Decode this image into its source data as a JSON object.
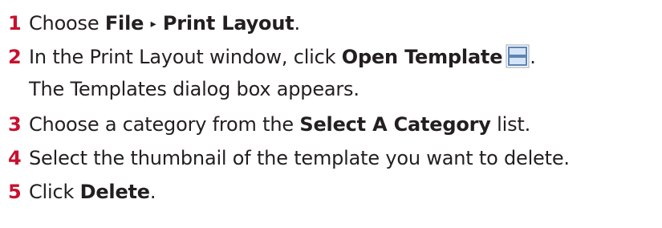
{
  "steps": [
    {
      "number": "1",
      "pre": "Choose ",
      "bold_a": "File",
      "arrow": "▸",
      "bold_b": "Print Layout",
      "post": "."
    },
    {
      "number": "2",
      "pre": "In the Print Layout window, click ",
      "bold": "Open Template",
      "icon": "open-template-icon",
      "post": ".",
      "result": "The Templates dialog box appears."
    },
    {
      "number": "3",
      "pre": "Choose a category from the ",
      "bold": "Select A Category",
      "post": " list."
    },
    {
      "number": "4",
      "text": "Select the thumbnail of the template you want to delete."
    },
    {
      "number": "5",
      "pre": "Click ",
      "bold": "Delete",
      "post": "."
    }
  ],
  "colors": {
    "step_number": "#c8102e",
    "text": "#231f20",
    "icon_frame": "#5f84b4",
    "icon_fill": "#d4e5f7"
  }
}
